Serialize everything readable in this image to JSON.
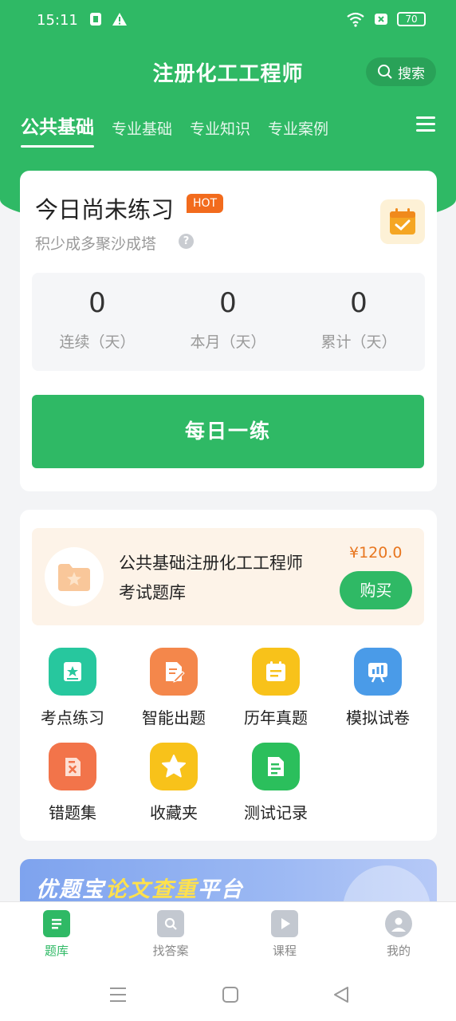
{
  "status": {
    "time": "15:11",
    "battery": "70"
  },
  "header": {
    "title": "注册化工工程师",
    "search_label": "搜索",
    "tabs": [
      {
        "label": "公共基础"
      },
      {
        "label": "专业基础"
      },
      {
        "label": "专业知识"
      },
      {
        "label": "专业案例"
      }
    ]
  },
  "practice": {
    "title": "今日尚未练习",
    "badge": "HOT",
    "subtitle": "积少成多聚沙成塔",
    "stats": [
      {
        "value": "0",
        "label": "连续（天）"
      },
      {
        "value": "0",
        "label": "本月（天）"
      },
      {
        "value": "0",
        "label": "累计（天）"
      }
    ],
    "daily_button": "每日一练"
  },
  "bank": {
    "product_name": "公共基础注册化工工程师考试题库",
    "price": "¥120.0",
    "buy_label": "购买",
    "features": [
      {
        "label": "考点练习",
        "icon": "star-doc-icon",
        "color": "#27c79e"
      },
      {
        "label": "智能出题",
        "icon": "edit-doc-icon",
        "color": "#f4874b"
      },
      {
        "label": "历年真题",
        "icon": "calendar-icon",
        "color": "#f8c21a"
      },
      {
        "label": "模拟试卷",
        "icon": "chart-board-icon",
        "color": "#4a9be8"
      },
      {
        "label": "错题集",
        "icon": "wrong-doc-icon",
        "color": "#f2744a"
      },
      {
        "label": "收藏夹",
        "icon": "star-icon",
        "color": "#f8c21a"
      },
      {
        "label": "测试记录",
        "icon": "record-doc-icon",
        "color": "#2bbf5c"
      }
    ]
  },
  "banner": {
    "text_a": "优题宝",
    "text_b": "论文查重",
    "text_c": "平台"
  },
  "bottom_nav": [
    {
      "label": "题库",
      "icon": "question-bank-icon"
    },
    {
      "label": "找答案",
      "icon": "find-answer-icon"
    },
    {
      "label": "课程",
      "icon": "course-play-icon"
    },
    {
      "label": "我的",
      "icon": "profile-icon"
    }
  ],
  "colors": {
    "brand_green": "#2fb965",
    "price_orange": "#e8761f",
    "hot_orange": "#f26b1d"
  }
}
